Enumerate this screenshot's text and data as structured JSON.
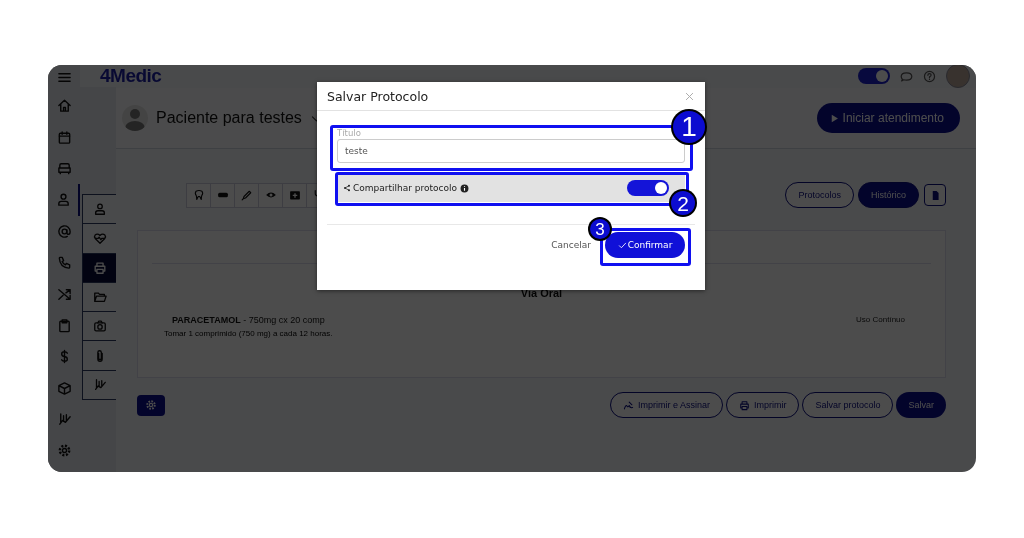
{
  "app": {
    "logo": "4Medic",
    "theme_toggle": {
      "on": true
    },
    "rail_items": [
      {
        "selected": false
      },
      {
        "selected": false
      },
      {
        "selected": false
      },
      {
        "selected": true
      },
      {
        "selected": false
      },
      {
        "selected": false
      },
      {
        "selected": false
      },
      {
        "selected": false
      },
      {
        "selected": false
      },
      {
        "selected": false
      },
      {
        "selected": false
      },
      {
        "selected": false
      }
    ],
    "patient": "Paciente para testes",
    "start_button": "Iniciar atendimento",
    "side_tabs": [
      {
        "selected": false
      },
      {
        "selected": false
      },
      {
        "selected": true
      },
      {
        "selected": false
      },
      {
        "selected": false
      },
      {
        "selected": false
      },
      {
        "selected": false
      }
    ],
    "view_buttons": [
      {
        "label": "Protocolos",
        "selected": false
      },
      {
        "label": "Histórico",
        "selected": true
      }
    ],
    "prescription": {
      "heading": "Via Oral",
      "items": [
        {
          "name": "PARACETAMOL",
          "detail": " - 750mg cx 20 comp",
          "instruction": "Tomar 1 comprimido (750 mg) a cada 12 horas.",
          "usage": "Uso Contínuo"
        }
      ]
    },
    "actions": [
      {
        "label": "Imprimir e Assinar",
        "kind": "sign"
      },
      {
        "label": "Imprimir",
        "kind": "print"
      },
      {
        "label": "Salvar protocolo",
        "kind": "outline"
      },
      {
        "label": "Salvar",
        "kind": "primary"
      }
    ]
  },
  "dialog": {
    "title": "Salvar Protocolo",
    "field_label": "Título",
    "field_value": "teste",
    "share_label": "Compartilhar protocolo",
    "share_on": true,
    "cancel": "Cancelar",
    "confirm": "Confirmar"
  },
  "callouts": [
    "1",
    "2",
    "3"
  ]
}
